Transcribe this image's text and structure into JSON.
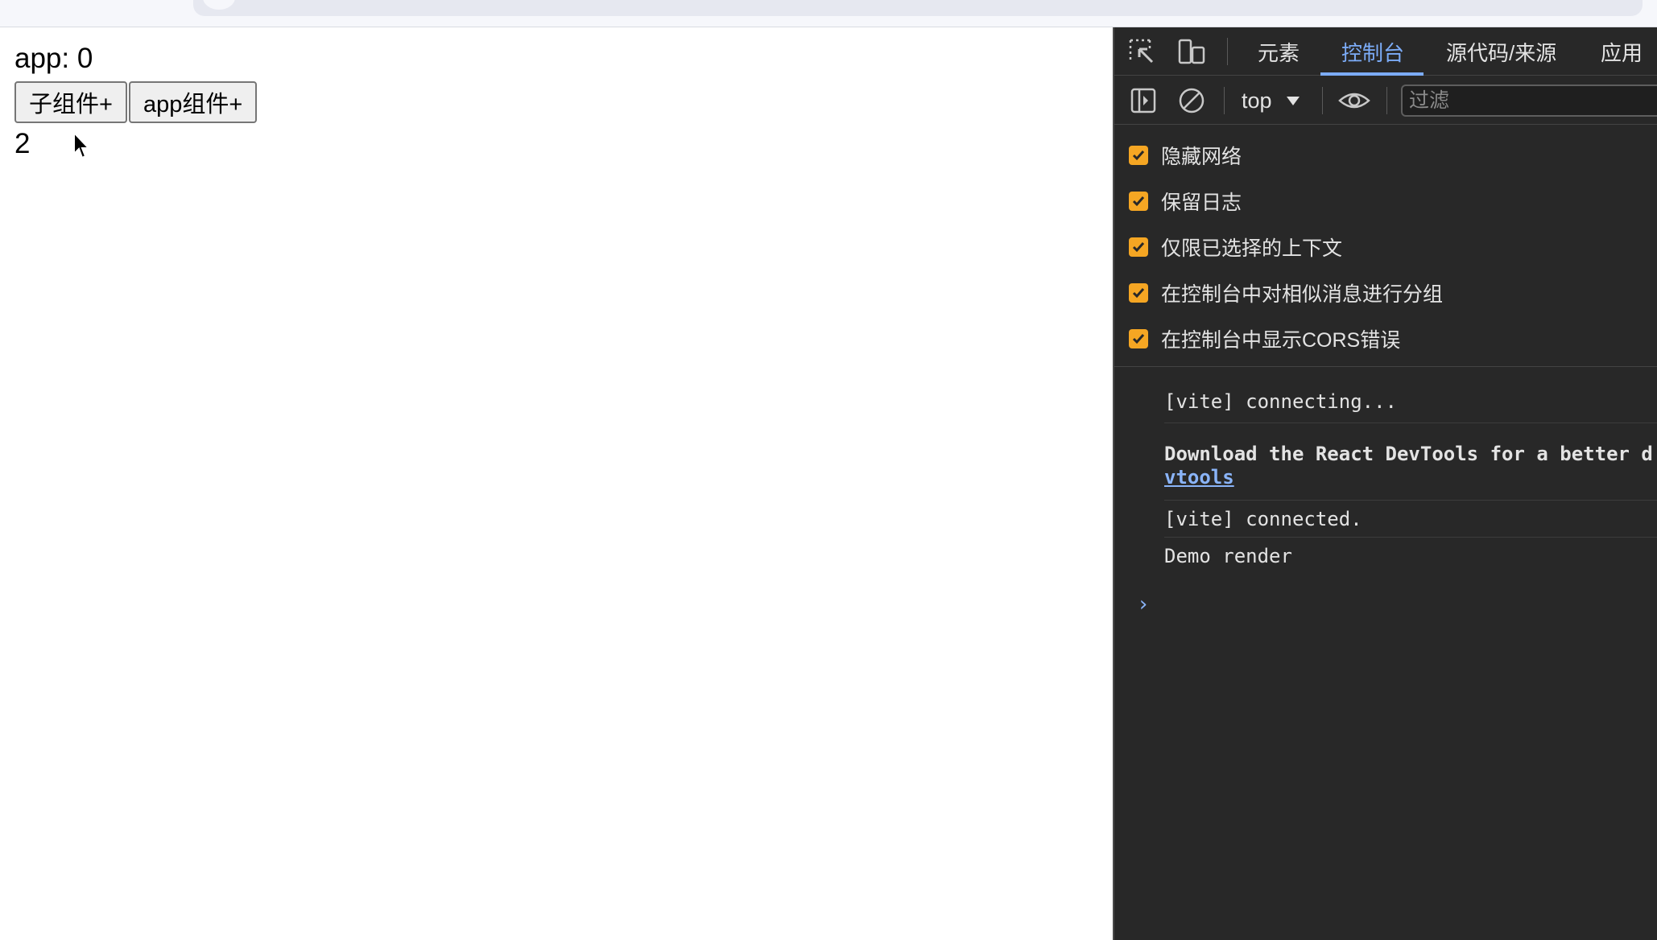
{
  "page": {
    "app_line": "app: 0",
    "buttons": {
      "child": "子组件+",
      "app": "app组件+"
    },
    "count": "2"
  },
  "devtools": {
    "tabs": [
      "元素",
      "控制台",
      "源代码/来源",
      "应用"
    ],
    "active_tab": "控制台",
    "context": "top",
    "filter_placeholder": "过滤",
    "settings": [
      {
        "label": "隐藏网络",
        "checked": true
      },
      {
        "label": "保留日志",
        "checked": true
      },
      {
        "label": "仅限已选择的上下文",
        "checked": true
      },
      {
        "label": "在控制台中对相似消息进行分组",
        "checked": true
      },
      {
        "label": "在控制台中显示CORS错误",
        "checked": true
      }
    ],
    "messages": {
      "m1": "[vite] connecting...",
      "m2_line1": "Download the React DevTools for a better d",
      "m2_link": "vtools",
      "m3": "[vite] connected.",
      "m4": "Demo render"
    },
    "prompt": "›"
  },
  "colors": {
    "accent": "#7cacf8",
    "checkbox": "#f5a623",
    "devtools_bg": "#282828"
  }
}
